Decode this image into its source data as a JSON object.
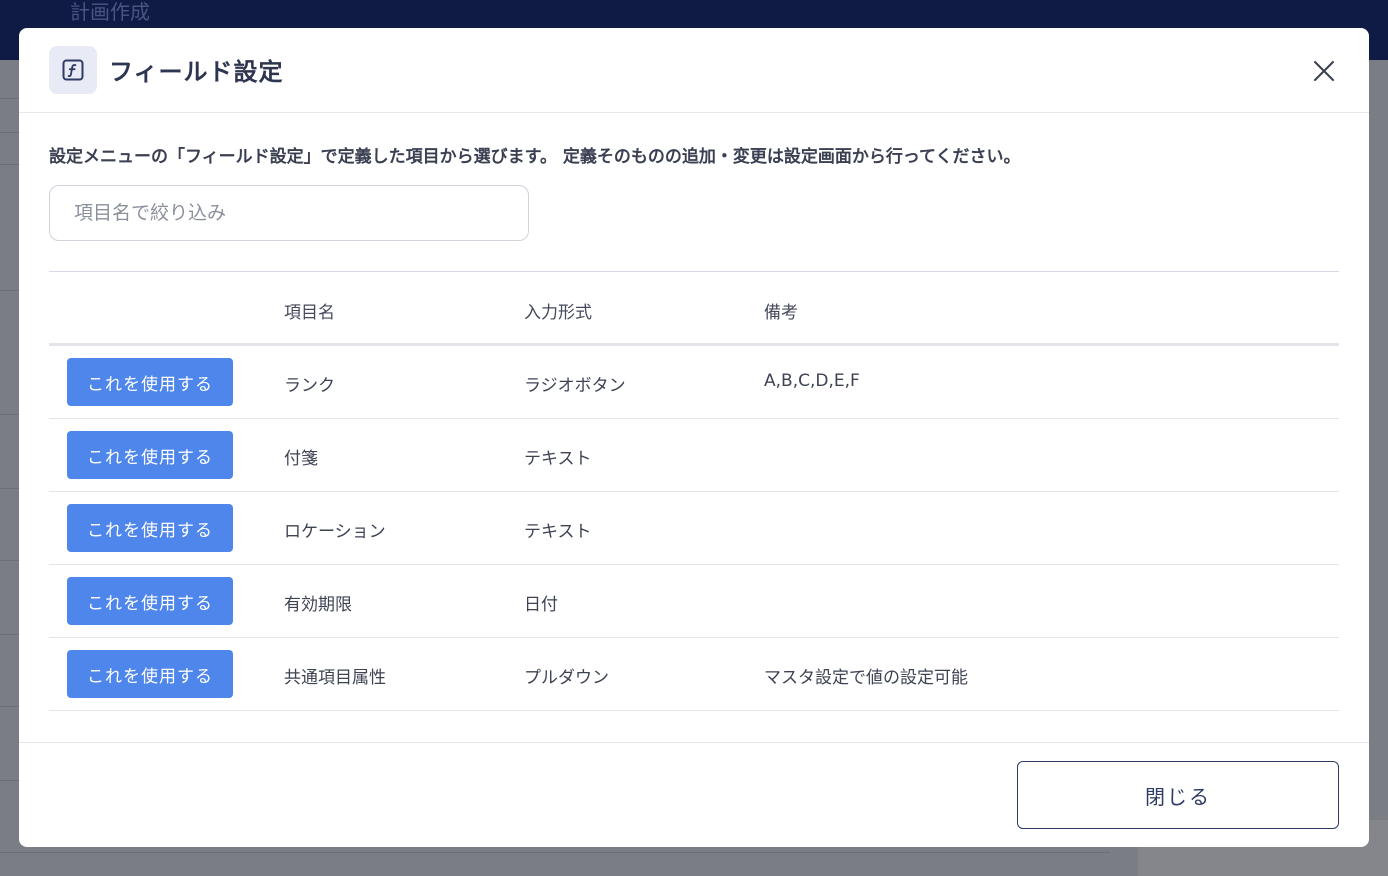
{
  "background": {
    "page_title": "計画作成"
  },
  "modal": {
    "title": "フィールド設定",
    "description": "設定メニューの「フィールド設定」で定義した項目から選びます。 定義そのものの追加・変更は設定画面から行ってください。",
    "filter": {
      "placeholder": "項目名で絞り込み",
      "value": ""
    },
    "table": {
      "headers": {
        "action": "",
        "name": "項目名",
        "type": "入力形式",
        "note": "備考"
      },
      "rows": [
        {
          "button": "これを使用する",
          "name": "ランク",
          "type": "ラジオボタン",
          "note": "A,B,C,D,E,F"
        },
        {
          "button": "これを使用する",
          "name": "付箋",
          "type": "テキスト",
          "note": ""
        },
        {
          "button": "これを使用する",
          "name": "ロケーション",
          "type": "テキスト",
          "note": ""
        },
        {
          "button": "これを使用する",
          "name": "有効期限",
          "type": "日付",
          "note": ""
        },
        {
          "button": "これを使用する",
          "name": "共通項目属性",
          "type": "プルダウン",
          "note": "マスタ設定で値の設定可能"
        }
      ]
    },
    "footer": {
      "close_label": "閉じる"
    }
  },
  "colors": {
    "primary_button": "#4f86ec",
    "header_bg": "#0f1a45",
    "outline_button": "#2f3a66"
  },
  "icons": {
    "header": "function-icon",
    "close": "close-icon"
  }
}
